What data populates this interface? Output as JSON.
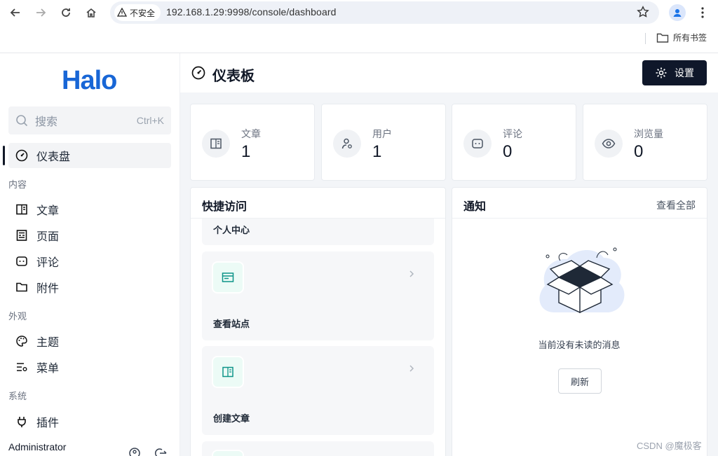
{
  "browser": {
    "security_label": "不安全",
    "url": "192.168.1.29:9998/console/dashboard",
    "bookmarks_label": "所有书签"
  },
  "sidebar": {
    "logo": "Halo",
    "search_placeholder": "搜索",
    "search_shortcut": "Ctrl+K",
    "dashboard_label": "仪表盘",
    "groups": {
      "content": "内容",
      "appearance": "外观",
      "system": "系统"
    },
    "items": {
      "posts": "文章",
      "pages": "页面",
      "comments": "评论",
      "attachments": "附件",
      "themes": "主题",
      "menus": "菜单",
      "plugins": "插件"
    },
    "user_name": "Administrator"
  },
  "header": {
    "title": "仪表板",
    "settings_label": "设置"
  },
  "stats": [
    {
      "label": "文章",
      "value": "1",
      "icon": "book-icon"
    },
    {
      "label": "用户",
      "value": "1",
      "icon": "user-gear-icon"
    },
    {
      "label": "评论",
      "value": "0",
      "icon": "comment-icon"
    },
    {
      "label": "浏览量",
      "value": "0",
      "icon": "eye-icon"
    }
  ],
  "quick_access": {
    "title": "快捷访问",
    "items": [
      "个人中心",
      "查看站点",
      "创建文章"
    ]
  },
  "notifications": {
    "title": "通知",
    "view_all": "查看全部",
    "empty_message": "当前没有未读的消息",
    "refresh_label": "刷新"
  },
  "watermark": "CSDN @魔极客",
  "colors": {
    "brand": "#1866d6",
    "primary_button": "#0f172a",
    "quick_icon": "#0d9488"
  }
}
